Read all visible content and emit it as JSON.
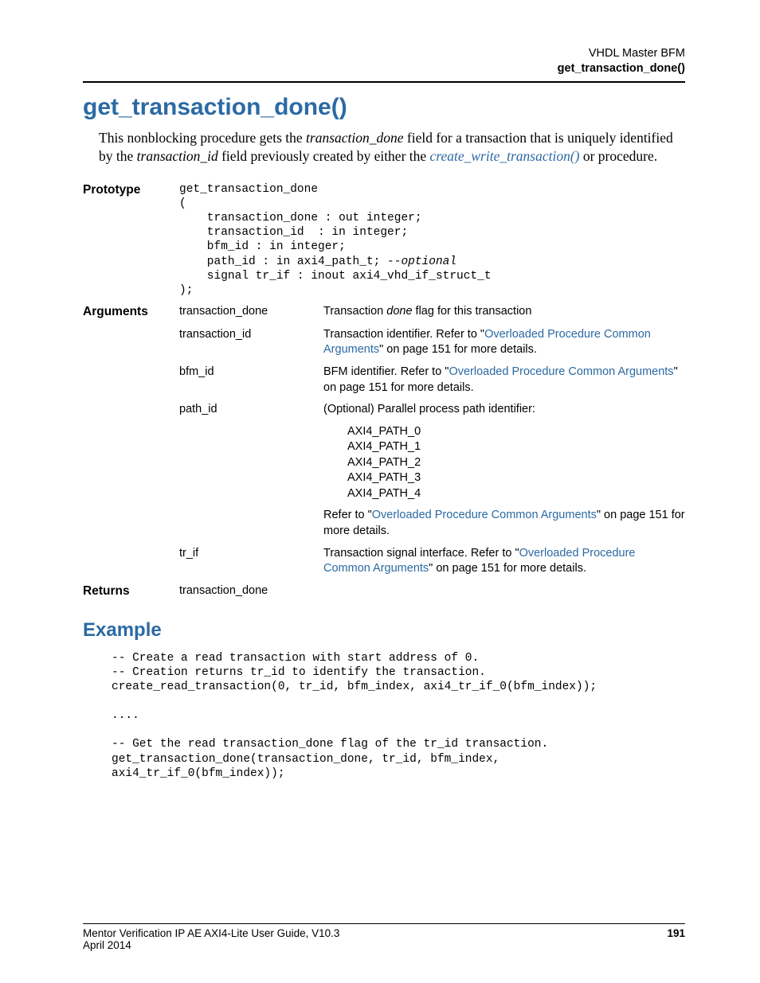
{
  "header": {
    "line1": "VHDL Master BFM",
    "line2": "get_transaction_done()"
  },
  "title": "get_transaction_done()",
  "intro": {
    "pre1": "This nonblocking procedure gets the ",
    "ital1": "transaction_done",
    "mid1": " field for a transaction that is uniquely identified by the ",
    "ital2": "transaction_id",
    "mid2": " field previously created by either the ",
    "link1": "create_write_transaction()",
    "tail": " or  procedure."
  },
  "labels": {
    "prototype": "Prototype",
    "arguments": "Arguments",
    "returns": "Returns"
  },
  "prototype": {
    "line1": "get_transaction_done",
    "line2": "(",
    "line3": "    transaction_done : out integer;",
    "line4": "    transaction_id  : in integer;",
    "line5": "    bfm_id : in integer;",
    "line6a": "    path_id : in axi4_path_t; ",
    "line6b": "--optional",
    "line7": "    signal tr_if : inout axi4_vhd_if_struct_t",
    "line8": ");"
  },
  "args": {
    "transaction_done": {
      "name": "transaction_done",
      "pre": "Transaction ",
      "ital": "done",
      "post": " flag for this transaction"
    },
    "transaction_id": {
      "name": "transaction_id",
      "pre": "Transaction identifier. Refer to \"",
      "link": "Overloaded Procedure Common Arguments",
      "post": "\" on page 151 for more details."
    },
    "bfm_id": {
      "name": "bfm_id",
      "pre": "BFM identifier. Refer to \"",
      "link": "Overloaded Procedure Common Arguments",
      "post": "\" on page 151 for more details."
    },
    "path_id": {
      "name": "path_id",
      "desc": "(Optional) Parallel process path identifier:",
      "paths": "AXI4_PATH_0\nAXI4_PATH_1\nAXI4_PATH_2\nAXI4_PATH_3\nAXI4_PATH_4",
      "refer_pre": "Refer to \"",
      "refer_link": "Overloaded Procedure Common Arguments",
      "refer_post": "\" on page 151 for more details."
    },
    "tr_if": {
      "name": "tr_if",
      "pre": "Transaction signal interface. Refer to \"",
      "link": "Overloaded Procedure Common Arguments",
      "post": "\" on page 151 for more details."
    }
  },
  "returns": "transaction_done",
  "example": {
    "heading": "Example",
    "code": "-- Create a read transaction with start address of 0.\n-- Creation returns tr_id to identify the transaction.\ncreate_read_transaction(0, tr_id, bfm_index, axi4_tr_if_0(bfm_index));\n\n....\n\n-- Get the read transaction_done flag of the tr_id transaction.\nget_transaction_done(transaction_done, tr_id, bfm_index,\naxi4_tr_if_0(bfm_index));"
  },
  "footer": {
    "left1": "Mentor Verification IP AE AXI4-Lite User Guide, V10.3",
    "left2": "April 2014",
    "pagenum": "191"
  }
}
